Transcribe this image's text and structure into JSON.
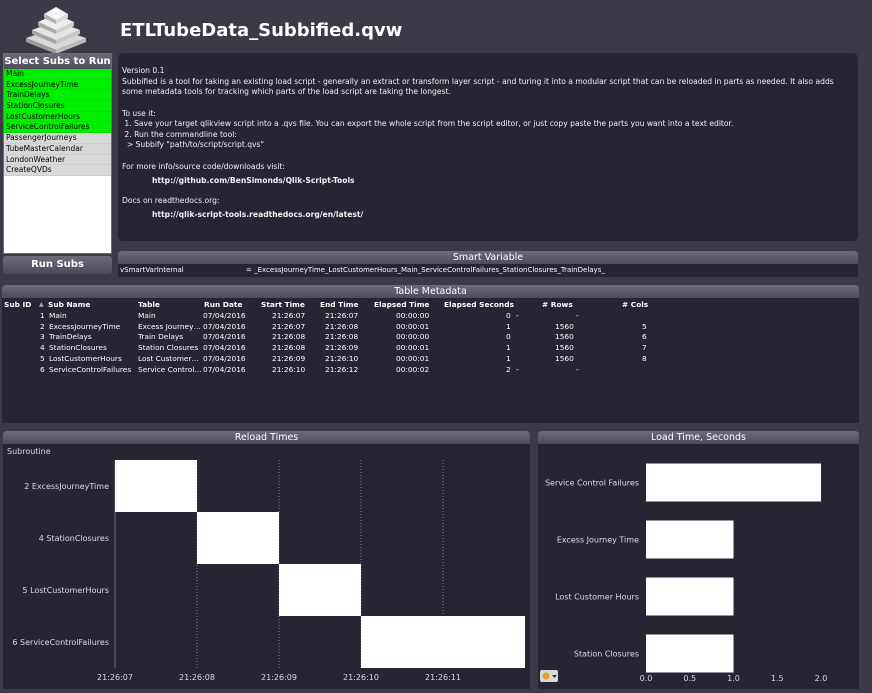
{
  "app": {
    "title": "ETLTubeData_Subbified.qvw"
  },
  "subs_panel": {
    "header": "Select Subs to Run",
    "items": [
      {
        "label": "Main",
        "state": "selected"
      },
      {
        "label": "ExcessJourneyTime",
        "state": "selected"
      },
      {
        "label": "TrainDelays",
        "state": "selected"
      },
      {
        "label": "StationClosures",
        "state": "selected"
      },
      {
        "label": "LostCustomerHours",
        "state": "selected"
      },
      {
        "label": "ServiceControlFailures",
        "state": "selected"
      },
      {
        "label": "PassengerJourneys",
        "state": "excluded"
      },
      {
        "label": "TubeMasterCalendar",
        "state": "excluded"
      },
      {
        "label": "LondonWeather",
        "state": "excluded"
      },
      {
        "label": "CreateQVDs",
        "state": "excluded"
      }
    ],
    "run_button": "Run Subs"
  },
  "info": {
    "version": "Version 0.1",
    "description": "Subbified is a tool for taking an existing load script - generally an extract or transform layer script - and turing it into a modular script that can be reloaded in parts as needed. It also adds some metadata tools for tracking which parts of the load script are taking the longest.",
    "use_heading": "To use it:",
    "step1": " 1. Save your target qlikview script into a .qvs file. You can export the whole script from the script editor, or just copy paste the parts you want into a text editor.",
    "step2": " 2. Run the commandline tool:",
    "step3": "  > Subbify \"path/to/script/script.qvs\"",
    "more_info": "For more info/source code/downloads visit:",
    "github_link": "http://github.com/BenSimonds/Qlik-Script-Tools",
    "docs_heading": "Docs on readthedocs.org:",
    "docs_link": "http://qlik-script-tools.readthedocs.org/en/latest/"
  },
  "smart_variable": {
    "caption": "Smart Variable",
    "name": "vSmartVarInternal",
    "value": "= _ExcessJourneyTime_LostCustomerHours_Main_ServiceControlFailures_StationClosures_TrainDelays_"
  },
  "table_metadata": {
    "caption": "Table Metadata",
    "columns": [
      "Sub ID",
      "Sub Name",
      "Table",
      "Run Date",
      "Start Time",
      "End Time",
      "Elapsed Time",
      "Elapsed Seconds",
      "# Rows",
      "# Cols"
    ],
    "sort_indicator": "▲",
    "rows": [
      [
        "1",
        "Main",
        "Main",
        "07/04/2016",
        "21:26:07",
        "21:26:07",
        "00:00:00",
        "0",
        "-",
        "-"
      ],
      [
        "2",
        "ExcessJourneyTime",
        "Excess Journey…",
        "07/04/2016",
        "21:26:07",
        "21:26:08",
        "00:00:01",
        "1",
        "1560",
        "5"
      ],
      [
        "3",
        "TrainDelays",
        "Train Delays",
        "07/04/2016",
        "21:26:08",
        "21:26:08",
        "00:00:00",
        "0",
        "1560",
        "6"
      ],
      [
        "4",
        "StationClosures",
        "Station Closures",
        "07/04/2016",
        "21:26:08",
        "21:26:09",
        "00:00:01",
        "1",
        "1560",
        "7"
      ],
      [
        "5",
        "LostCustomerHours",
        "Lost Customer…",
        "07/04/2016",
        "21:26:09",
        "21:26:10",
        "00:00:01",
        "1",
        "1560",
        "8"
      ],
      [
        "6",
        "ServiceControlFailures",
        "Service Control…",
        "07/04/2016",
        "21:26:10",
        "21:26:12",
        "00:00:02",
        "2",
        "-",
        "-"
      ]
    ]
  },
  "chart_data": [
    {
      "type": "bar",
      "orientation": "horizontal",
      "style": "gantt",
      "title": "Reload Times",
      "ylabel": "Subroutine",
      "categories": [
        "2 ExcessJourneyTime",
        "4 StationClosures",
        "5 LostCustomerHours",
        "6 ServiceControlFailures"
      ],
      "start": [
        "21:26:07",
        "21:26:08",
        "21:26:09",
        "21:26:10"
      ],
      "end": [
        "21:26:08",
        "21:26:09",
        "21:26:10",
        "21:26:12"
      ],
      "x_ticks": [
        "21:26:07",
        "21:26:08",
        "21:26:09",
        "21:26:10",
        "21:26:11"
      ],
      "grid": true,
      "bar_color": "#ffffff"
    },
    {
      "type": "bar",
      "orientation": "horizontal",
      "title": "Load Time, Seconds",
      "categories": [
        "Service Control Failures",
        "Excess Journey Time",
        "Lost Customer Hours",
        "Station Closures"
      ],
      "values": [
        2.0,
        1.0,
        1.0,
        1.0
      ],
      "xlim": [
        0,
        2.0
      ],
      "x_ticks": [
        "0.0",
        "0.5",
        "1.0",
        "1.5",
        "2.0"
      ],
      "bar_color": "#ffffff"
    }
  ],
  "colors": {
    "background": "#3b3b48",
    "panel": "#252533",
    "selected": "#00ee00",
    "excluded": "#d8d8d8"
  }
}
